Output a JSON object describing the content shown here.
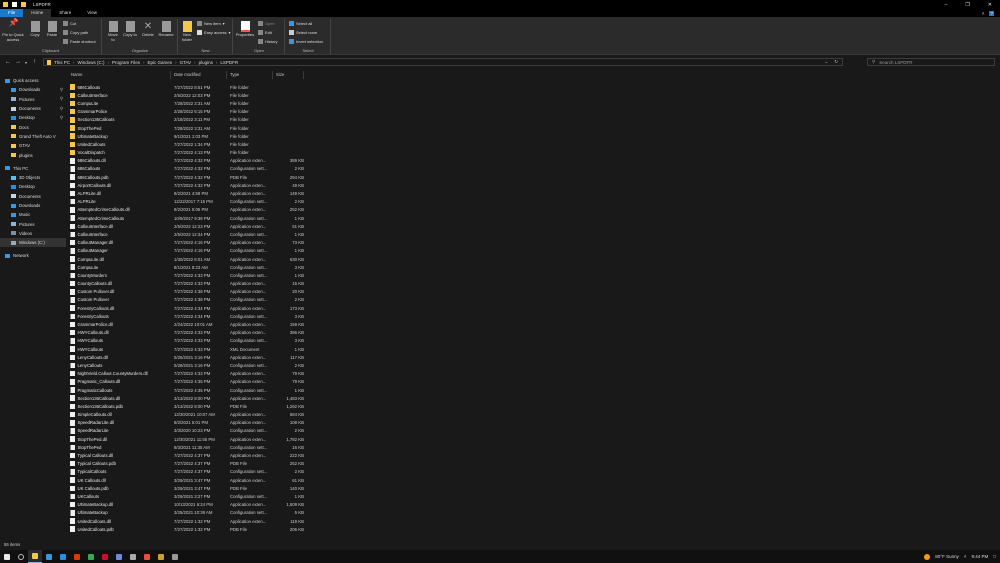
{
  "window": {
    "title": "LSPDFR",
    "minimize_icon": "minimize-icon",
    "maximize_icon": "restore-icon",
    "close_icon": "close-icon"
  },
  "colors": {
    "accent": "#1979ca",
    "folder": "#f3c84b",
    "background": "#191919",
    "ribbon": "#2b2b2b"
  },
  "tabs": [
    "File",
    "Home",
    "Share",
    "View"
  ],
  "ribbon": {
    "clipboard": {
      "label": "Clipboard",
      "pin": "Pin to Quick access",
      "copy": "Copy",
      "paste": "Paste",
      "cut": "Cut",
      "copy_path": "Copy path",
      "paste_shortcut": "Paste shortcut"
    },
    "organize": {
      "label": "Organize",
      "move_to": "Move to",
      "copy_to": "Copy to",
      "delete": "Delete",
      "rename": "Rename"
    },
    "new": {
      "label": "New",
      "new_folder": "New folder",
      "new_item": "New item",
      "easy_access": "Easy access"
    },
    "open": {
      "label": "Open",
      "properties": "Properties",
      "open": "Open",
      "edit": "Edit",
      "history": "History"
    },
    "select": {
      "label": "Select",
      "select_all": "Select all",
      "select_none": "Select none",
      "invert": "Invert selection"
    }
  },
  "address": {
    "path": [
      "This PC",
      "Windows (C:)",
      "Program Files",
      "Epic Games",
      "GTAV",
      "plugins",
      "LSPDFR"
    ],
    "search_placeholder": "Search LSPDFR"
  },
  "sidebar": [
    {
      "label": "Quick access",
      "icon": "star-icon",
      "color": "#3a96dd",
      "indent": 0
    },
    {
      "label": "Downloads",
      "icon": "download-icon",
      "color": "#3a96dd",
      "indent": 1
    },
    {
      "label": "Pictures",
      "icon": "pictures-icon",
      "color": "#8fb3d9",
      "indent": 1
    },
    {
      "label": "Documents",
      "icon": "documents-icon",
      "color": "#c8d4e4",
      "indent": 1
    },
    {
      "label": "Desktop",
      "icon": "desktop-icon",
      "color": "#2a8ee0",
      "indent": 1
    },
    {
      "label": "Docs",
      "icon": "folder-icon",
      "color": "#f3c84b",
      "indent": 1
    },
    {
      "label": "Grand Theft Auto V",
      "icon": "folder-icon",
      "color": "#f3c84b",
      "indent": 1
    },
    {
      "label": "GTAV",
      "icon": "folder-icon",
      "color": "#f3c84b",
      "indent": 1
    },
    {
      "label": "plugins",
      "icon": "folder-icon",
      "color": "#f3c84b",
      "indent": 1
    },
    {
      "label": "This PC",
      "icon": "computer-icon",
      "color": "#3a96dd",
      "indent": 0
    },
    {
      "label": "3D Objects",
      "icon": "3d-objects-icon",
      "color": "#4fc3f7",
      "indent": 1
    },
    {
      "label": "Desktop",
      "icon": "desktop-icon",
      "color": "#2a8ee0",
      "indent": 1
    },
    {
      "label": "Documents",
      "icon": "documents-icon",
      "color": "#c8d4e4",
      "indent": 1
    },
    {
      "label": "Downloads",
      "icon": "download-icon",
      "color": "#3a96dd",
      "indent": 1
    },
    {
      "label": "Music",
      "icon": "music-icon",
      "color": "#3a96dd",
      "indent": 1
    },
    {
      "label": "Pictures",
      "icon": "pictures-icon",
      "color": "#8fb3d9",
      "indent": 1
    },
    {
      "label": "Videos",
      "icon": "videos-icon",
      "color": "#7b8fa8",
      "indent": 1
    },
    {
      "label": "Windows (C:)",
      "icon": "drive-icon",
      "color": "#9ab",
      "indent": 1,
      "selected": true
    },
    {
      "label": "Network",
      "icon": "network-icon",
      "color": "#3a96dd",
      "indent": 0
    }
  ],
  "columns": [
    "Name",
    "Date modified",
    "Type",
    "Size"
  ],
  "files": [
    [
      "686Callouts",
      "7/27/2022 8:51 PM",
      "File folder",
      "",
      "folder"
    ],
    [
      "CalloutInterface",
      "2/5/2022 12:03 PM",
      "File folder",
      "",
      "folder"
    ],
    [
      "CompuLite",
      "7/28/2022 3:31 AM",
      "File folder",
      "",
      "folder"
    ],
    [
      "GrammarPolice",
      "2/28/2022 8:15 PM",
      "File folder",
      "",
      "folder"
    ],
    [
      "Section136Callouts",
      "2/18/2022 3:11 PM",
      "File folder",
      "",
      "folder"
    ],
    [
      "StopThePed",
      "7/28/2022 3:31 AM",
      "File folder",
      "",
      "folder"
    ],
    [
      "UltimateBackup",
      "9/1/2021 1:03 PM",
      "File folder",
      "",
      "folder"
    ],
    [
      "UnitedCallouts",
      "7/27/2022 1:34 PM",
      "File folder",
      "",
      "folder"
    ],
    [
      "VocalDispatch",
      "7/27/2022 4:13 PM",
      "File folder",
      "",
      "folder"
    ],
    [
      "686Callouts.dll",
      "7/27/2022 4:32 PM",
      "Application exten...",
      "389 KB",
      "dll"
    ],
    [
      "686Callouts",
      "7/27/2022 4:32 PM",
      "Configuration sett...",
      "2 KB",
      "ini"
    ],
    [
      "686Callouts.pdb",
      "7/27/2022 4:32 PM",
      "PDB File",
      "294 KB",
      "file"
    ],
    [
      "AirportCallouts.dll",
      "7/27/2022 4:32 PM",
      "Application exten...",
      "49 KB",
      "dll"
    ],
    [
      "ALPRLite.dll",
      "8/2/2021 4:59 PM",
      "Application exten...",
      "149 KB",
      "dll"
    ],
    [
      "ALPRLite",
      "12/22/2017 7:16 PM",
      "Configuration sett...",
      "2 KB",
      "ini"
    ],
    [
      "AttemptedCrimeCallouts.dll",
      "8/2/2021 5:06 PM",
      "Application exten...",
      "252 KB",
      "dll"
    ],
    [
      "AttemptedCrimeCallouts",
      "10/9/2017 9:38 PM",
      "Configuration sett...",
      "1 KB",
      "ini"
    ],
    [
      "CalloutInterface.dll",
      "2/5/2022 12:23 PM",
      "Application exten...",
      "51 KB",
      "dll"
    ],
    [
      "CalloutInterface",
      "2/5/2022 12:34 PM",
      "Configuration sett...",
      "1 KB",
      "ini"
    ],
    [
      "CalloutManager.dll",
      "7/27/2022 4:16 PM",
      "Application exten...",
      "73 KB",
      "dll"
    ],
    [
      "CalloutManager",
      "7/27/2022 4:16 PM",
      "Configuration sett...",
      "1 KB",
      "ini"
    ],
    [
      "CompuLite.dll",
      "1/30/2022 8:01 AM",
      "Application exten...",
      "630 KB",
      "dll"
    ],
    [
      "CompuLite",
      "8/1/2021 8:23 AM",
      "Configuration sett...",
      "3 KB",
      "ini"
    ],
    [
      "CountyMurders",
      "7/27/2022 4:33 PM",
      "Configuration sett...",
      "1 KB",
      "ini"
    ],
    [
      "CountyCallouts.dll",
      "7/27/2022 4:33 PM",
      "Application exten...",
      "15 KB",
      "dll"
    ],
    [
      "Custom Pullover.dll",
      "7/27/2022 4:38 PM",
      "Application exten...",
      "20 KB",
      "dll"
    ],
    [
      "Custom Pullover",
      "7/27/2022 4:38 PM",
      "Configuration sett...",
      "2 KB",
      "ini"
    ],
    [
      "ForestryCallouts.dll",
      "7/27/2022 4:34 PM",
      "Application exten...",
      "173 KB",
      "dll"
    ],
    [
      "ForestryCallouts",
      "7/27/2022 4:34 PM",
      "Configuration sett...",
      "3 KB",
      "ini"
    ],
    [
      "GrammarPolice.dll",
      "2/24/2022 10:01 AM",
      "Application exten...",
      "159 KB",
      "dll"
    ],
    [
      "HWYCallouts.dll",
      "7/27/2022 4:33 PM",
      "Application exten...",
      "386 KB",
      "dll"
    ],
    [
      "HWYCallouts",
      "7/27/2022 4:33 PM",
      "Configuration sett...",
      "3 KB",
      "ini"
    ],
    [
      "HWYCallouts",
      "7/27/2022 4:33 PM",
      "XML Document",
      "1 KB",
      "file"
    ],
    [
      "LenyCallouts.dll",
      "5/25/2021 3:16 PM",
      "Application exten...",
      "117 KB",
      "dll"
    ],
    [
      "LenyCallouts",
      "5/28/2021 3:16 PM",
      "Configuration sett...",
      "2 KB",
      "ini"
    ],
    [
      "NightVield.Callout.CountyMurders.dll",
      "7/27/2022 4:33 PM",
      "Application exten...",
      "79 KB",
      "dll"
    ],
    [
      "Pragmatic_Callouts.dll",
      "7/27/2022 4:35 PM",
      "Application exten...",
      "79 KB",
      "dll"
    ],
    [
      "PragmaticCallouts",
      "7/27/2022 4:35 PM",
      "Configuration sett...",
      "1 KB",
      "ini"
    ],
    [
      "Section136Callouts.dll",
      "3/13/2022 8:00 PM",
      "Application exten...",
      "1,483 KB",
      "dll"
    ],
    [
      "Section136Callouts.pdb",
      "3/13/2022 8:00 PM",
      "PDB File",
      "1,292 KB",
      "file"
    ],
    [
      "SimpleCallouts.dll",
      "12/30/2021 10:07 AM",
      "Application exten...",
      "684 KB",
      "dll"
    ],
    [
      "SpeedRadarLite.dll",
      "8/2/2021 5:01 PM",
      "Application exten...",
      "108 KB",
      "dll"
    ],
    [
      "SpeedRadarLite",
      "3/3/2020 10:23 PM",
      "Configuration sett...",
      "2 KB",
      "ini"
    ],
    [
      "StopThePed.dll",
      "12/30/2021 11:55 PM",
      "Application exten...",
      "1,782 KB",
      "dll"
    ],
    [
      "StopThePed",
      "8/3/2021 11:35 AM",
      "Configuration sett...",
      "16 KB",
      "ini"
    ],
    [
      "Typical Callouts.dll",
      "7/27/2022 4:37 PM",
      "Application exten...",
      "222 KB",
      "dll"
    ],
    [
      "Typical Callouts.pdb",
      "7/27/2022 4:37 PM",
      "PDB File",
      "252 KB",
      "file"
    ],
    [
      "TypicalCallouts",
      "7/27/2022 4:37 PM",
      "Configuration sett...",
      "2 KB",
      "ini"
    ],
    [
      "UK Callouts.dll",
      "3/29/2021 3:47 PM",
      "Application exten...",
      "61 KB",
      "dll"
    ],
    [
      "UK Callouts.pdb",
      "3/29/2021 3:47 PM",
      "PDB File",
      "140 KB",
      "file"
    ],
    [
      "UKCallouts",
      "3/29/2021 3:27 PM",
      "Configuration sett...",
      "1 KB",
      "ini"
    ],
    [
      "UltimateBackup.dll",
      "10/13/2021 6:24 PM",
      "Application exten...",
      "1,509 KB",
      "dll"
    ],
    [
      "UltimateBackup",
      "3/25/2021 10:38 AM",
      "Configuration sett...",
      "5 KB",
      "ini"
    ],
    [
      "UnitedCallouts.dll",
      "7/27/2022 1:32 PM",
      "Application exten...",
      "119 KB",
      "dll"
    ],
    [
      "UnitedCallouts.pdb",
      "7/27/2022 1:32 PM",
      "PDB File",
      "206 KB",
      "file"
    ]
  ],
  "status": {
    "item_count": "55 items"
  },
  "taskbar": {
    "apps": [
      {
        "icon": "start-icon",
        "color": "#e6e6e6"
      },
      {
        "icon": "search-icon",
        "color": "#bbb"
      },
      {
        "icon": "file-explorer-icon",
        "color": "#f3c84b",
        "active": true
      },
      {
        "icon": "store-icon",
        "color": "#3a96dd"
      },
      {
        "icon": "mail-icon",
        "color": "#2a8ee0"
      },
      {
        "icon": "office-icon",
        "color": "#d83b01"
      },
      {
        "icon": "chrome-icon",
        "color": "#34a853"
      },
      {
        "icon": "opera-icon",
        "color": "#c8102e"
      },
      {
        "icon": "discord-icon",
        "color": "#7289da"
      },
      {
        "icon": "monitor-app-icon",
        "color": "#aaa"
      },
      {
        "icon": "app-red-icon",
        "color": "#e74c3c"
      },
      {
        "icon": "app-gold-icon",
        "color": "#c9a227"
      },
      {
        "icon": "app-grey-icon",
        "color": "#999"
      }
    ],
    "weather": "80°F  Sunny",
    "time": "9:44 PM"
  }
}
